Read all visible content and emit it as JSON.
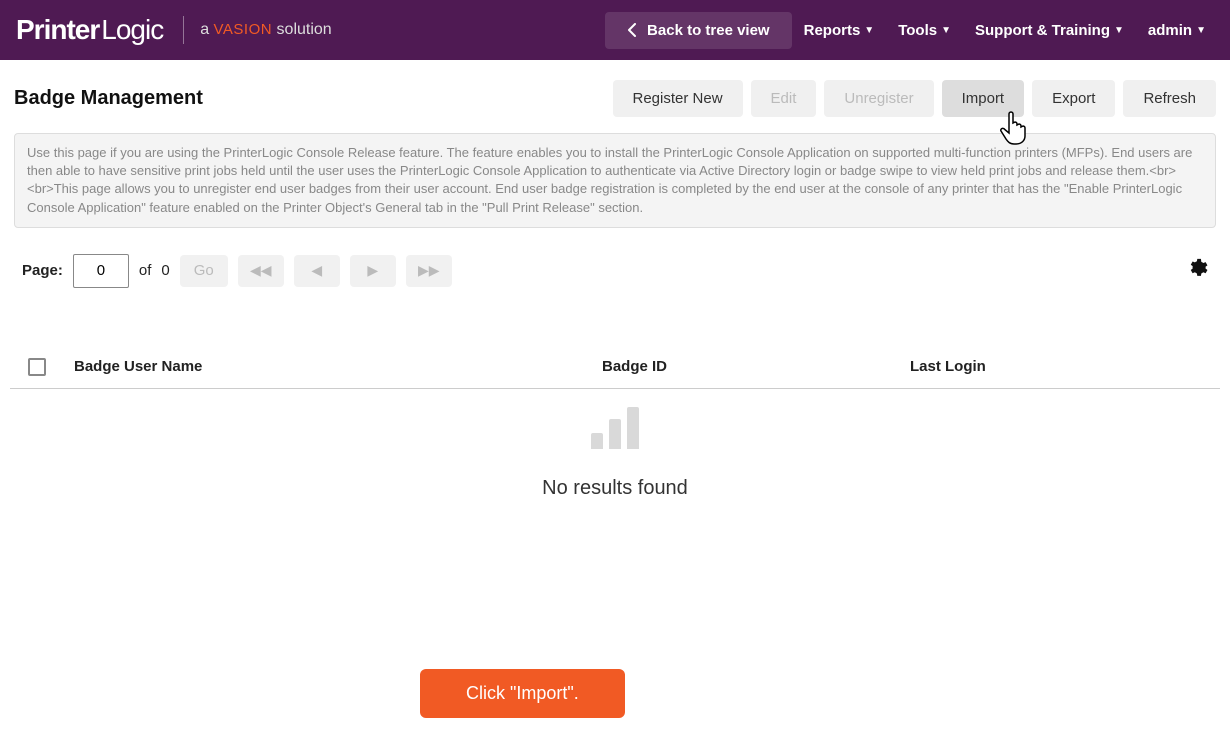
{
  "header": {
    "logo_part1": "Printer",
    "logo_part2": "Logic",
    "tagline_prefix": "a ",
    "tagline_brand": "VASION",
    "tagline_suffix": " solution",
    "back_label": "Back to tree view",
    "nav": {
      "reports": "Reports",
      "tools": "Tools",
      "support": "Support & Training",
      "admin": "admin"
    }
  },
  "page": {
    "title": "Badge Management",
    "actions": {
      "register_new": "Register New",
      "edit": "Edit",
      "unregister": "Unregister",
      "import": "Import",
      "export": "Export",
      "refresh": "Refresh"
    },
    "info_text": "Use this page if you are using the PrinterLogic Console Release feature. The feature enables you to install the PrinterLogic Console Application on supported multi-function printers (MFPs). End users are then able to have sensitive print jobs held until the user uses the PrinterLogic Console Application to authenticate via Active Directory login or badge swipe to view held print jobs and release them.<br><br>This page allows you to unregister end user badges from their user account. End user badge registration is completed by the end user at the console of any printer that has the \"Enable PrinterLogic Console Application\" feature enabled on the Printer Object's General tab in the \"Pull Print Release\" section."
  },
  "pager": {
    "label": "Page:",
    "value": "0",
    "of": "of",
    "total": "0",
    "go": "Go"
  },
  "table": {
    "col_user": "Badge User Name",
    "col_badge": "Badge ID",
    "col_last": "Last Login",
    "empty": "No results found"
  },
  "tooltip": "Click \"Import\"."
}
